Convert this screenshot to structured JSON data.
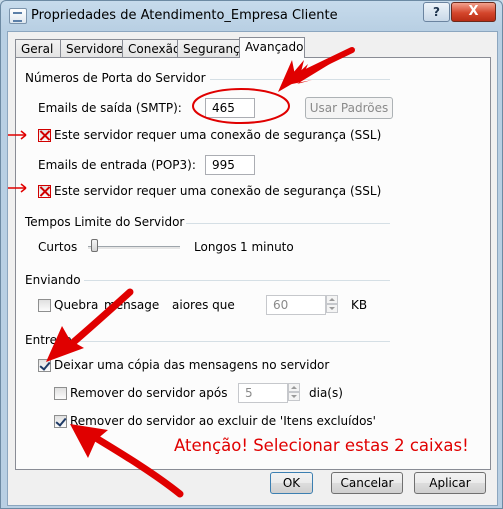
{
  "window": {
    "title": "Propriedades de Atendimento_Empresa Cliente",
    "help_label": "?",
    "close_label": "X"
  },
  "tabs": [
    "Geral",
    "Servidores",
    "Conexão",
    "Segurança",
    "Avançado"
  ],
  "active_tab": "Avançado",
  "ports_group": {
    "title": "Números de Porta do Servidor",
    "smtp_label": "Emails de saída (SMTP):",
    "smtp_value": "465",
    "defaults_button": "Usar Padrões",
    "smtp_ssl_label": "Este servidor requer uma conexão de segurança (SSL)",
    "pop3_label": "Emails de entrada (POP3):",
    "pop3_value": "995",
    "pop3_ssl_label": "Este servidor requer uma conexão de segurança (SSL)"
  },
  "timeouts_group": {
    "title": "Tempos Limite do Servidor",
    "short_label": "Curtos",
    "long_label": "Longos",
    "value_text": "1 minuto"
  },
  "sending_group": {
    "title": "Enviando",
    "break_label_1": "Quebra",
    "break_label_2": "mensage",
    "break_label_3": "aiores que",
    "break_value": "60",
    "break_unit": "KB"
  },
  "delivery_group": {
    "title": "Entrega",
    "leave_copy_label": "Deixar uma cópia das mensagens no servidor",
    "remove_after_label": "Remover do servidor após",
    "remove_after_value": "5",
    "remove_after_unit": "dia(s)",
    "remove_on_delete_label": "Remover do servidor ao excluir de 'Itens excluídos'"
  },
  "annotation": "Atenção! Selecionar estas 2 caixas!",
  "buttons": {
    "ok": "OK",
    "cancel": "Cancelar",
    "apply": "Aplicar"
  },
  "colors": {
    "annotation_red": "#e00000"
  }
}
